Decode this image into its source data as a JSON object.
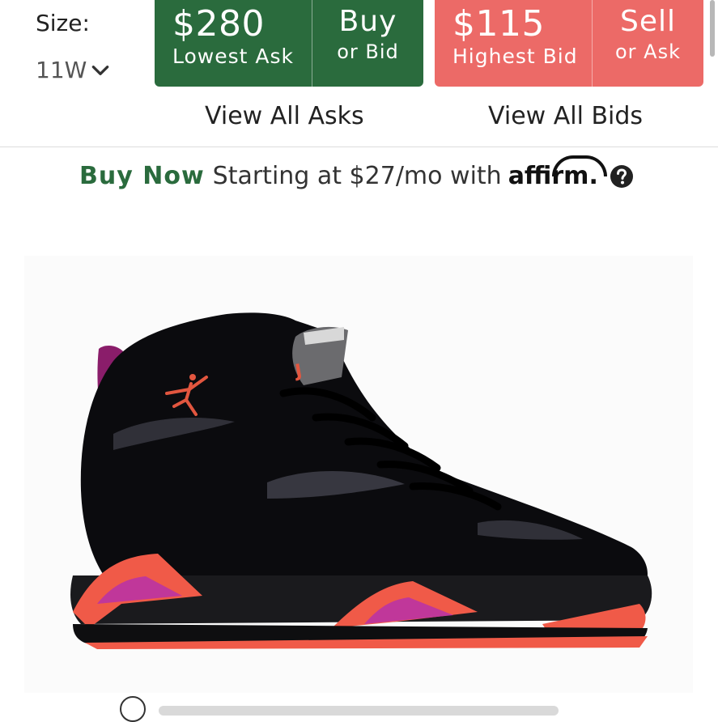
{
  "size": {
    "label": "Size:",
    "value": "11W"
  },
  "buy_button": {
    "price": "$280",
    "caption": "Lowest Ask",
    "action": "Buy",
    "sub": "or Bid"
  },
  "sell_button": {
    "price": "$115",
    "caption": "Highest Bid",
    "action": "Sell",
    "sub": "or Ask"
  },
  "links": {
    "view_asks": "View All Asks",
    "view_bids": "View All Bids"
  },
  "affirm": {
    "buy_now": "Buy Now",
    "starting": "Starting at $27/mo with",
    "logo_text": "affirm"
  },
  "icons": {
    "size_dropdown": "chevron-down-icon",
    "help": "question-circle-icon",
    "product": "sneaker-image",
    "logo": "jumpman-logo"
  },
  "colors": {
    "buy": "#2a6b3d",
    "sell": "#ec6a67",
    "accent_green": "#2a6b3d"
  }
}
